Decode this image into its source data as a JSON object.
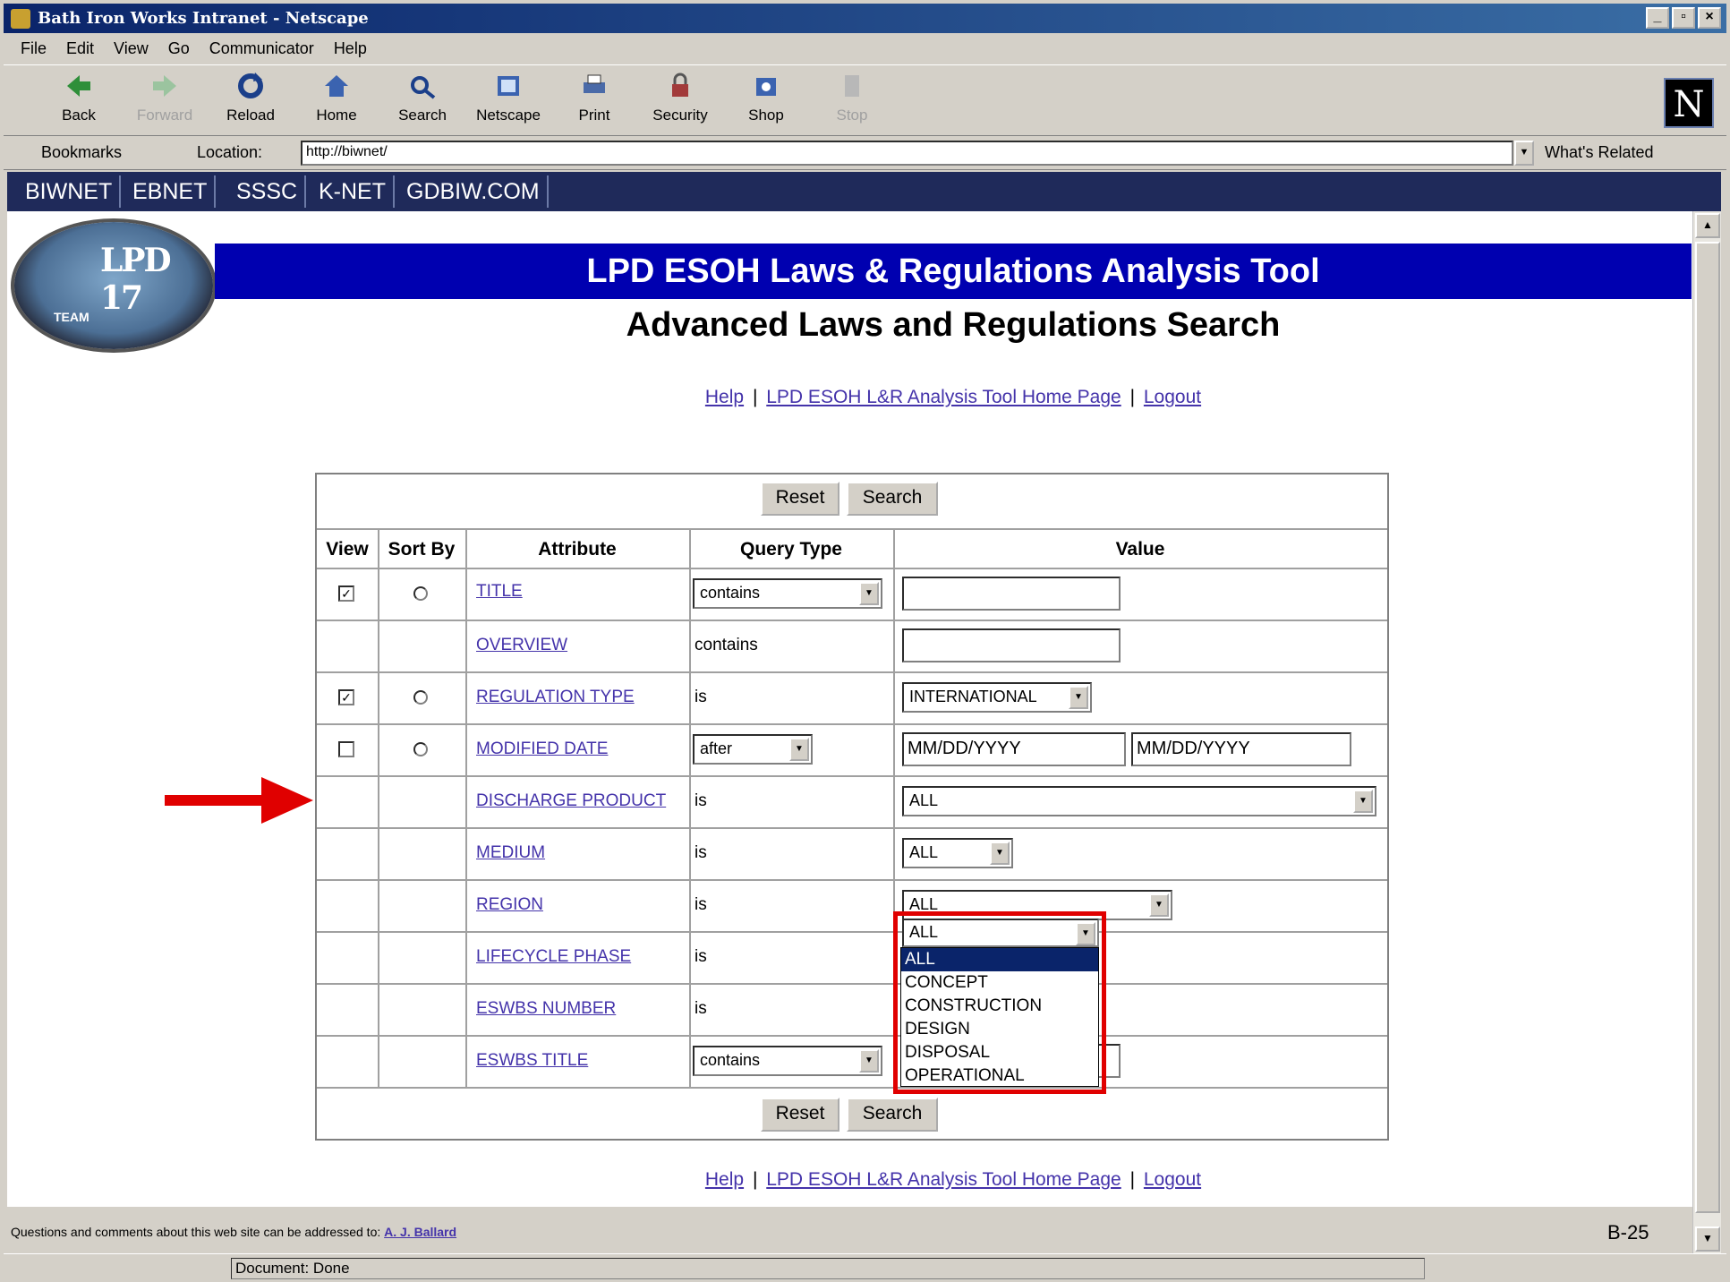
{
  "window": {
    "title": "Bath Iron Works Intranet - Netscape",
    "controls": [
      "_",
      "▫",
      "×"
    ]
  },
  "menu": [
    "File",
    "Edit",
    "View",
    "Go",
    "Communicator",
    "Help"
  ],
  "toolbar": [
    {
      "label": "Back",
      "icon": "back-icon",
      "enabled": true
    },
    {
      "label": "Forward",
      "icon": "forward-icon",
      "enabled": false
    },
    {
      "label": "Reload",
      "icon": "reload-icon",
      "enabled": true
    },
    {
      "label": "Home",
      "icon": "home-icon",
      "enabled": true
    },
    {
      "label": "Search",
      "icon": "search-icon",
      "enabled": true
    },
    {
      "label": "Netscape",
      "icon": "netscape-icon",
      "enabled": true
    },
    {
      "label": "Print",
      "icon": "print-icon",
      "enabled": true
    },
    {
      "label": "Security",
      "icon": "lock-icon",
      "enabled": true
    },
    {
      "label": "Shop",
      "icon": "shop-icon",
      "enabled": true
    },
    {
      "label": "Stop",
      "icon": "stop-icon",
      "enabled": false
    }
  ],
  "location": {
    "bookmarks": "Bookmarks",
    "label": "Location:",
    "url": "http://biwnet/",
    "related": "What's Related"
  },
  "navband": [
    "BIWNET",
    "EBNET",
    "SSSC",
    "K-NET",
    "GDBIW.COM"
  ],
  "page": {
    "logo_text": "LPD 17",
    "logo_subtext": "TEAM",
    "banner": "LPD ESOH Laws & Regulations Analysis Tool",
    "subtitle": "Advanced Laws and Regulations Search",
    "links": {
      "help": "Help",
      "home": "LPD ESOH L&R Analysis Tool Home Page",
      "logout": "Logout",
      "sep": "|"
    },
    "buttons": {
      "reset": "Reset",
      "search": "Search"
    },
    "headers": {
      "view": "View",
      "sort_by": "Sort By",
      "attribute": "Attribute",
      "query_type": "Query Type",
      "value": "Value"
    },
    "rows": {
      "title": {
        "attr": "TITLE",
        "query": "contains",
        "view": true
      },
      "overview": {
        "attr": "OVERVIEW",
        "query": "contains"
      },
      "regulation_type": {
        "attr": "REGULATION TYPE",
        "query": "is",
        "value": "INTERNATIONAL",
        "view": true
      },
      "modified_date": {
        "attr": "MODIFIED DATE",
        "query": "after",
        "value1": "MM/DD/YYYY",
        "value2": "MM/DD/YYYY",
        "view": false
      },
      "discharge_product": {
        "attr": "DISCHARGE PRODUCT",
        "query": "is",
        "value": "ALL"
      },
      "medium": {
        "attr": "MEDIUM",
        "query": "is",
        "value": "ALL"
      },
      "region": {
        "attr": "REGION",
        "query": "is",
        "value": "ALL"
      },
      "lifecycle_phase": {
        "attr": "LIFECYCLE PHASE",
        "query": "is",
        "value": "ALL",
        "options": [
          "ALL",
          "CONCEPT",
          "CONSTRUCTION",
          "DESIGN",
          "DISPOSAL",
          "OPERATIONAL"
        ]
      },
      "eswbs_number": {
        "attr": "ESWBS NUMBER",
        "query": "is"
      },
      "eswbs_title": {
        "attr": "ESWBS TITLE",
        "query": "contains"
      }
    },
    "footer": {
      "text": "Questions and comments about this web site can be addressed to:",
      "contact": "A. J. Ballard"
    },
    "page_label": "B-25"
  },
  "status": "Document: Done",
  "colors": {
    "banner": "#0000b0",
    "highlight": "#e00000",
    "title_bar": "#0a246a"
  }
}
